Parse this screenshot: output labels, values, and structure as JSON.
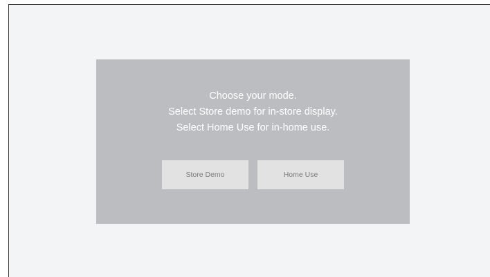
{
  "dialog": {
    "lines": [
      "Choose your mode.",
      "Select Store demo for in-store display.",
      "Select Home Use for in-home use."
    ],
    "buttons": {
      "store_demo": "Store Demo",
      "home_use": "Home Use"
    }
  },
  "colors": {
    "screen_background": "#f3f4f6",
    "dialog_background": "#bcbdc0",
    "button_background": "#e2e2e2",
    "message_text": "#ffffff",
    "button_text": "#7b7b7b"
  }
}
